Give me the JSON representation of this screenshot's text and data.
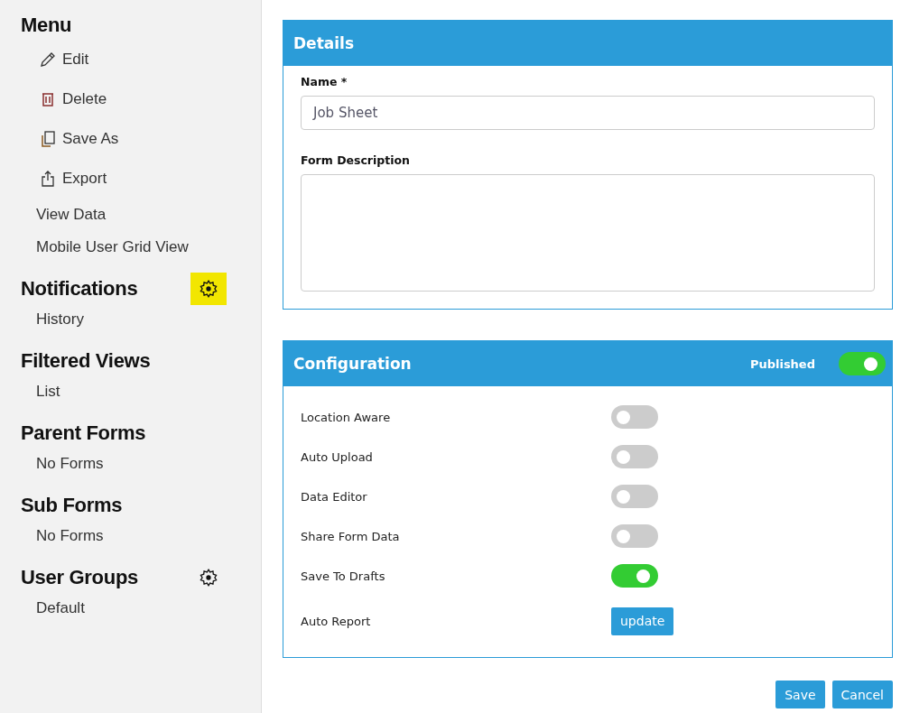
{
  "sidebar": {
    "sections": [
      {
        "title": "Menu",
        "items": [
          {
            "label": "Edit",
            "kind": "edit"
          },
          {
            "label": "Delete",
            "kind": "delete"
          },
          {
            "label": "Save As",
            "kind": "copy"
          },
          {
            "label": "Export",
            "kind": "export"
          },
          {
            "label": "View Data",
            "kind": "plain"
          },
          {
            "label": "Mobile User Grid View",
            "kind": "plain"
          }
        ]
      },
      {
        "title": "Notifications",
        "gear": {
          "highlighted": true
        },
        "items": [
          {
            "label": "History"
          }
        ]
      },
      {
        "title": "Filtered Views",
        "items": [
          {
            "label": "List"
          }
        ]
      },
      {
        "title": "Parent Forms",
        "items": [
          {
            "label": "No Forms"
          }
        ]
      },
      {
        "title": "Sub Forms",
        "items": [
          {
            "label": "No Forms"
          }
        ]
      },
      {
        "title": "User Groups",
        "gear": {
          "highlighted": false
        },
        "items": [
          {
            "label": "Default"
          }
        ]
      }
    ]
  },
  "details": {
    "title": "Details",
    "name_label": "Name *",
    "name_value": "Job Sheet",
    "description_label": "Form Description"
  },
  "configuration": {
    "title": "Configuration",
    "published_label": "Published",
    "published_on": true,
    "rows": [
      {
        "kind": "toggle",
        "label": "Location Aware",
        "on": false
      },
      {
        "kind": "toggle",
        "label": "Auto Upload",
        "on": false
      },
      {
        "kind": "toggle",
        "label": "Data Editor",
        "on": false
      },
      {
        "kind": "toggle",
        "label": "Share Form Data",
        "on": false
      },
      {
        "kind": "toggle",
        "label": "Save To Drafts",
        "on": true
      },
      {
        "kind": "button",
        "label": "Auto Report",
        "button": "update"
      }
    ]
  },
  "actions": [
    "Save",
    "Cancel"
  ]
}
